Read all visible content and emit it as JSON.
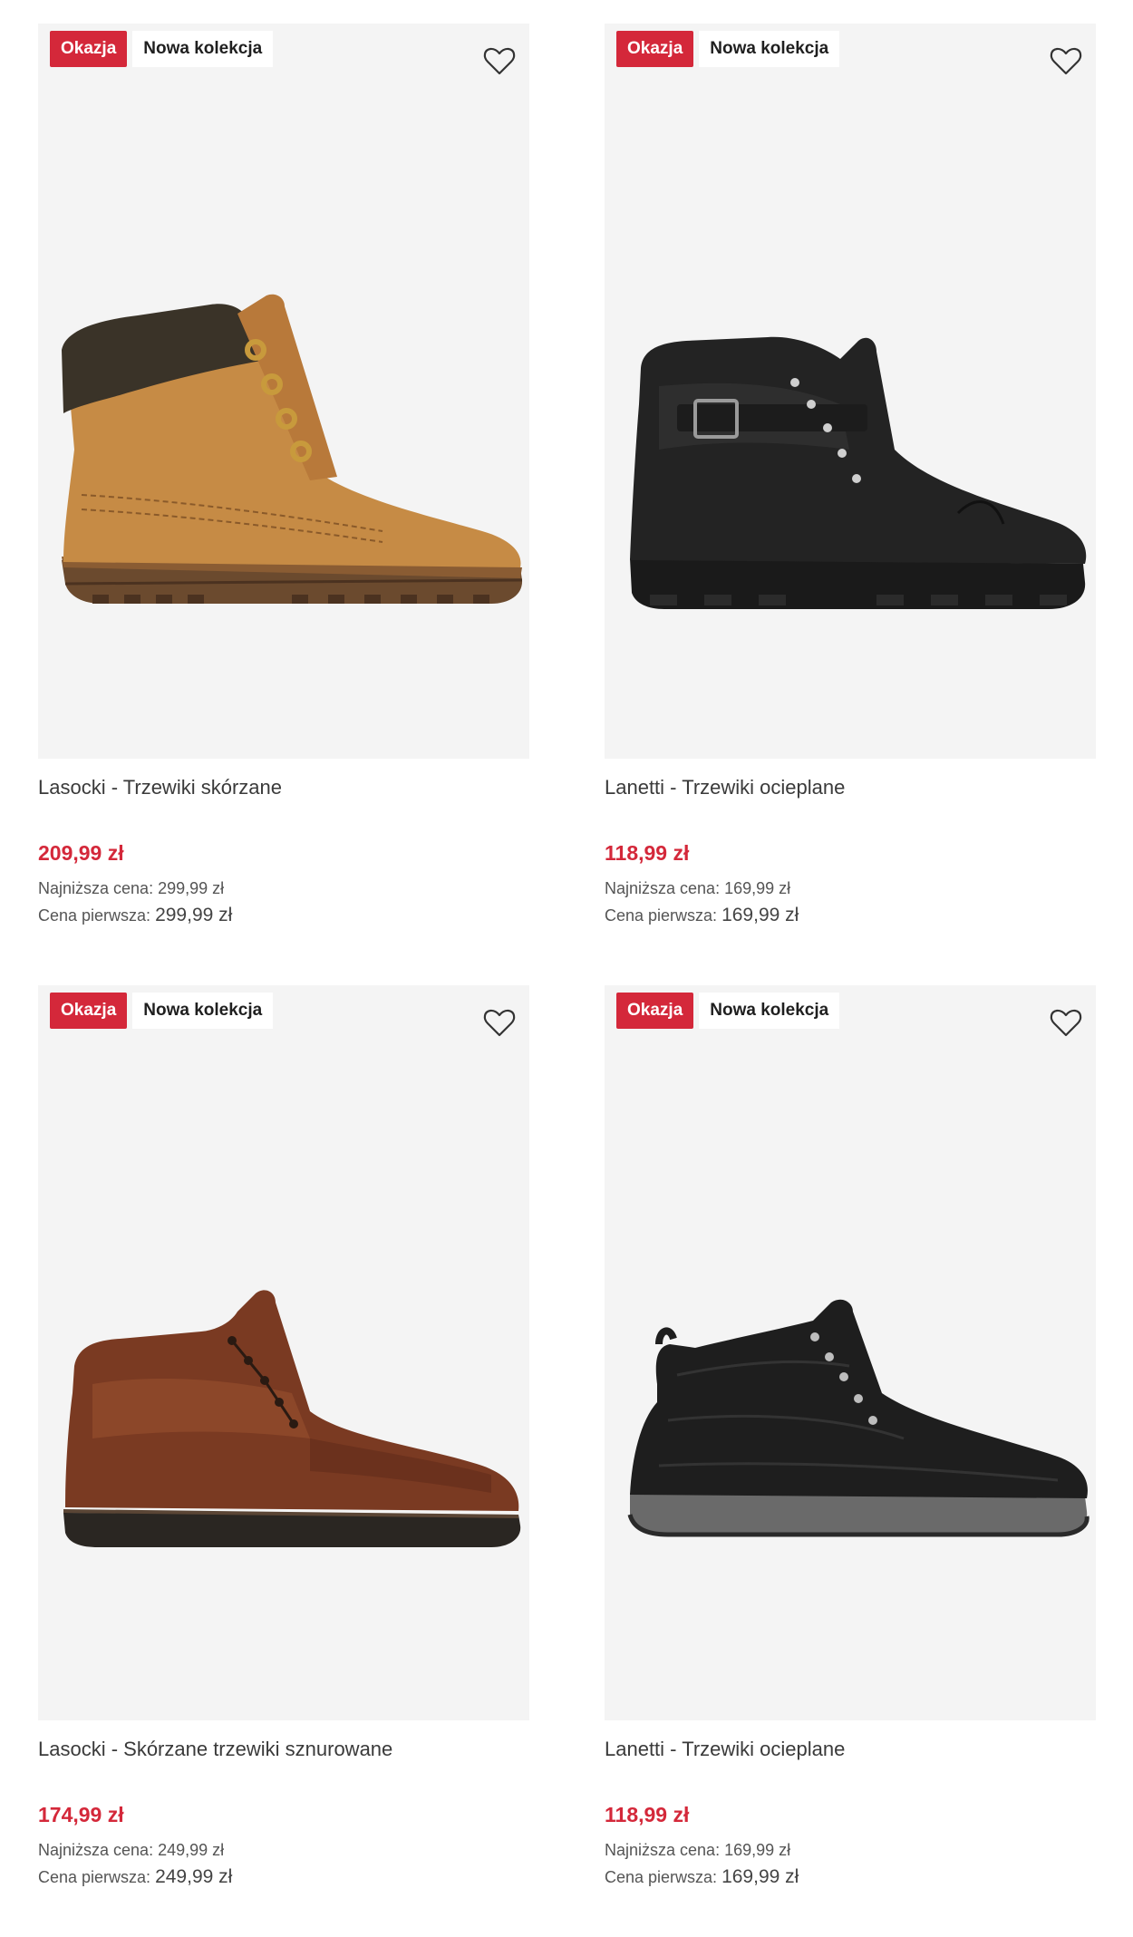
{
  "colors": {
    "sale_badge": "#d4283a",
    "price": "#d4283a",
    "image_background": "#f4f4f4"
  },
  "products": [
    {
      "badge_sale": "Okazja",
      "badge_new": "Nowa kolekcja",
      "wishlist_icon": "heart-outline-icon",
      "name": "Lasocki - Trzewiki skórzane",
      "price": "209,99 zł",
      "lowest_price": "Najniższa cena: 299,99 zł",
      "first_price_label": "Cena pierwsza:",
      "first_price_value": "299,99 zł",
      "image": "tan-work-boot-image"
    },
    {
      "badge_sale": "Okazja",
      "badge_new": "Nowa kolekcja",
      "wishlist_icon": "heart-outline-icon",
      "name": "Lanetti - Trzewiki ocieplane",
      "price": "118,99 zł",
      "lowest_price": "Najniższa cena: 169,99 zł",
      "first_price_label": "Cena pierwsza:",
      "first_price_value": "169,99 zł",
      "image": "black-buckle-boot-image"
    },
    {
      "badge_sale": "Okazja",
      "badge_new": "Nowa kolekcja",
      "wishlist_icon": "heart-outline-icon",
      "name": "Lasocki - Skórzane trzewiki sznurowane",
      "price": "174,99 zł",
      "lowest_price": "Najniższa cena: 249,99 zł",
      "first_price_label": "Cena pierwsza:",
      "first_price_value": "249,99 zł",
      "image": "brown-leather-chukka-image"
    },
    {
      "badge_sale": "Okazja",
      "badge_new": "Nowa kolekcja",
      "wishlist_icon": "heart-outline-icon",
      "name": "Lanetti - Trzewiki ocieplane",
      "price": "118,99 zł",
      "lowest_price": "Najniższa cena: 169,99 zł",
      "first_price_label": "Cena pierwsza:",
      "first_price_value": "169,99 zł",
      "image": "black-sneaker-boot-image"
    }
  ]
}
